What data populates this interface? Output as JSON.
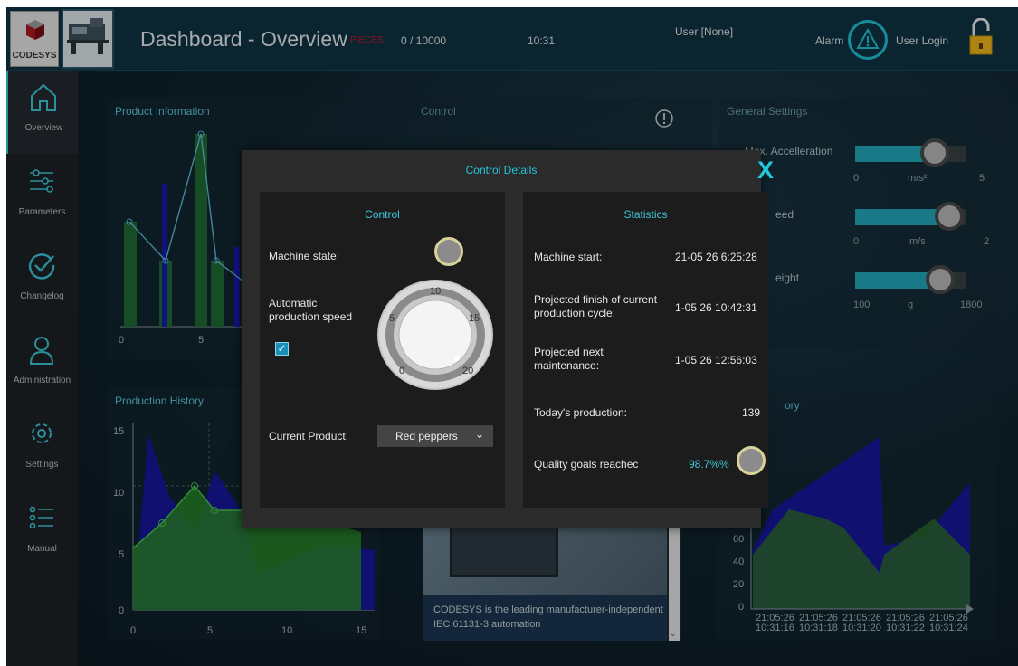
{
  "header": {
    "logo_text": "CODESYS",
    "title": "Dashboard - Overview",
    "pieces_label": "PIECES",
    "pieces_count": "0 / 10000",
    "time": "10:31",
    "user": "User [None]",
    "alarm_label": "Alarm",
    "login_label": "User Login",
    "alarm_icon": "warning-icon",
    "lock_icon": "padlock-icon"
  },
  "sidebar": {
    "items": [
      {
        "label": "Overview",
        "icon": "home-icon",
        "active": true
      },
      {
        "label": "Parameters",
        "icon": "sliders-icon",
        "active": false
      },
      {
        "label": "Changelog",
        "icon": "check-circle-icon",
        "active": false
      },
      {
        "label": "Administration",
        "icon": "user-icon",
        "active": false
      },
      {
        "label": "Settings",
        "icon": "gear-icon",
        "active": false
      },
      {
        "label": "Manual",
        "icon": "list-icon",
        "active": false
      }
    ]
  },
  "panels": {
    "product_information": {
      "title": "Product Information",
      "x_ticks": [
        "0",
        "5"
      ]
    },
    "control": {
      "title": "Control"
    },
    "general_settings": {
      "title": "General Settings",
      "rows": [
        {
          "label": "Max. Accelleration",
          "min": "0",
          "unit": "m/s²",
          "max": "5",
          "level": 0.72
        },
        {
          "label": "eed",
          "min": "0",
          "unit": "m/s",
          "max": "2",
          "level": 0.85
        },
        {
          "label": "eight",
          "min": "100",
          "unit": "g",
          "max": "1800",
          "level": 0.77
        }
      ]
    },
    "production_history": {
      "title": "Production History",
      "y_ticks": [
        "15",
        "10",
        "5",
        "0"
      ],
      "x_ticks": [
        "0",
        "5",
        "10",
        "15"
      ]
    },
    "info": {
      "text": "CODESYS is the leading manufacturer-independent IEC 61131-3 automation"
    },
    "history2": {
      "title": "ory",
      "y_ticks": [
        "60",
        "40",
        "20",
        "0"
      ],
      "x_ticks": [
        {
          "date": "21:05:26",
          "time": "10:31:16"
        },
        {
          "date": "21:05:26",
          "time": "10:31:18"
        },
        {
          "date": "21:05:26",
          "time": "10:31:20"
        },
        {
          "date": "21:05:26",
          "time": "10:31:22"
        },
        {
          "date": "21:05:26",
          "time": "10:31:24"
        }
      ]
    }
  },
  "modal": {
    "title": "Control Details",
    "close_label": "X",
    "control": {
      "title": "Control",
      "machine_state_label": "Machine state:",
      "auto_speed_label": "Automatic production speed",
      "auto_speed_checked": true,
      "knob_ticks": [
        "0",
        "5",
        "10",
        "15",
        "20"
      ],
      "current_product_label": "Current Product:",
      "current_product": "Red peppers"
    },
    "statistics": {
      "title": "Statistics",
      "rows": [
        {
          "label": "Machine start:",
          "value": "21-05 26 6:25:28"
        },
        {
          "label": "Projected finish of current production cycle:",
          "value": "1-05 26 10:42:31"
        },
        {
          "label": "Projected next maintenance:",
          "value": "1-05 26 12:56:03"
        },
        {
          "label": "Today's production:",
          "value": "139"
        }
      ],
      "quality_label": "Quality goals reachec",
      "quality_value": "98.7%%"
    }
  },
  "colors": {
    "accent": "#22c7da",
    "pieces_red": "#c2182b",
    "bar_green": "#1f6b34",
    "bar_blue": "#1a1ab0"
  }
}
